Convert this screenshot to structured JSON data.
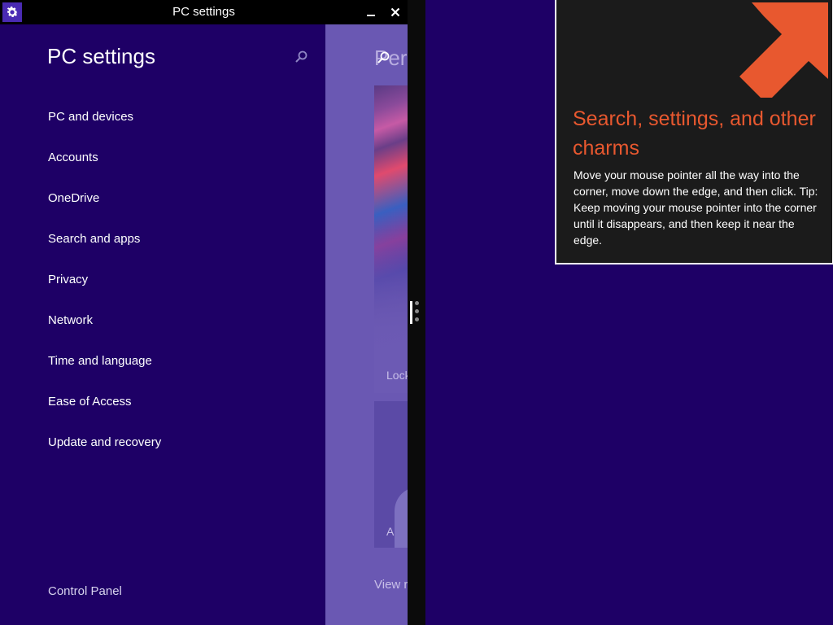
{
  "window": {
    "title": "PC settings",
    "icons": {
      "app": "gear-icon",
      "minimize": "minimize-icon",
      "close": "close-icon"
    }
  },
  "nav": {
    "title": "PC settings",
    "search_icon": "search-icon",
    "items": [
      {
        "label": "PC and devices"
      },
      {
        "label": "Accounts"
      },
      {
        "label": "OneDrive"
      },
      {
        "label": "Search and apps"
      },
      {
        "label": "Privacy"
      },
      {
        "label": "Network"
      },
      {
        "label": "Time and language"
      },
      {
        "label": "Ease of Access"
      },
      {
        "label": "Update and recovery"
      }
    ],
    "footer_link": "Control Panel"
  },
  "content": {
    "heading": "Pers",
    "lock_tile_label": "Lock",
    "account_tile_label": "A",
    "link": "View r"
  },
  "tip": {
    "title": "Search, settings, and other charms",
    "body": "Move your mouse pointer all the way into the corner, move down the edge, and then click. Tip: Keep moving your mouse pointer into the corner until it disappears, and then keep it near the edge.",
    "arrow_icon": "arrow-up-right-icon"
  },
  "colors": {
    "background": "#1e0066",
    "content_pane": "#6a58b3",
    "accent_orange": "#e8582f",
    "tip_background": "#1b1b1b"
  }
}
